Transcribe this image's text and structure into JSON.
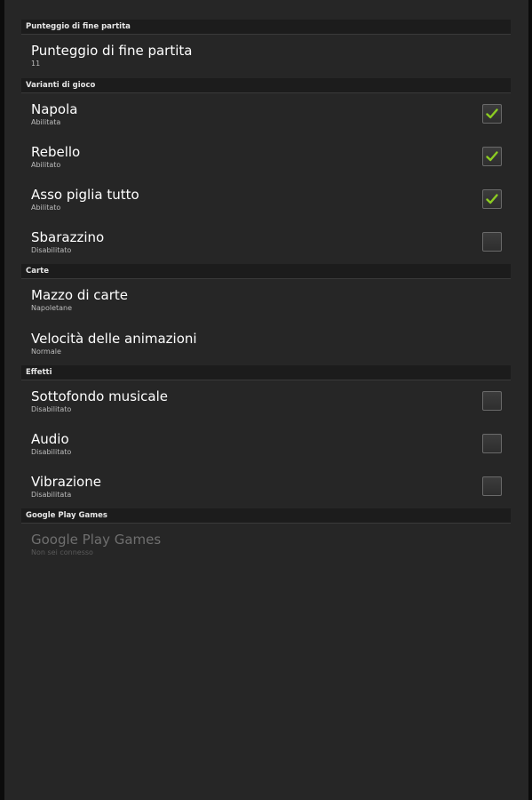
{
  "colors": {
    "background": "#262626",
    "header_background": "#1c1c1c",
    "check_green": "#8ccc22"
  },
  "sections": [
    {
      "header": "Punteggio di fine partita",
      "items": [
        {
          "title": "Punteggio di fine partita",
          "summary": "11"
        }
      ]
    },
    {
      "header": "Varianti di gioco",
      "items": [
        {
          "title": "Napola",
          "summary": "Abilitata",
          "checked": true
        },
        {
          "title": "Rebello",
          "summary": "Abilitato",
          "checked": true
        },
        {
          "title": "Asso piglia tutto",
          "summary": "Abilitato",
          "checked": true
        },
        {
          "title": "Sbarazzino",
          "summary": "Disabilitato",
          "checked": false
        }
      ]
    },
    {
      "header": "Carte",
      "items": [
        {
          "title": "Mazzo di carte",
          "summary": "Napoletane"
        },
        {
          "title": "Velocità delle animazioni",
          "summary": "Normale"
        }
      ]
    },
    {
      "header": "Effetti",
      "items": [
        {
          "title": "Sottofondo musicale",
          "summary": "Disabilitato",
          "checked": false
        },
        {
          "title": "Audio",
          "summary": "Disabilitato",
          "checked": false
        },
        {
          "title": "Vibrazione",
          "summary": "Disabilitata",
          "checked": false
        }
      ]
    },
    {
      "header": "Google Play Games",
      "items": [
        {
          "title": "Google Play Games",
          "summary": "Non sei connesso",
          "disabled": true
        }
      ]
    }
  ]
}
